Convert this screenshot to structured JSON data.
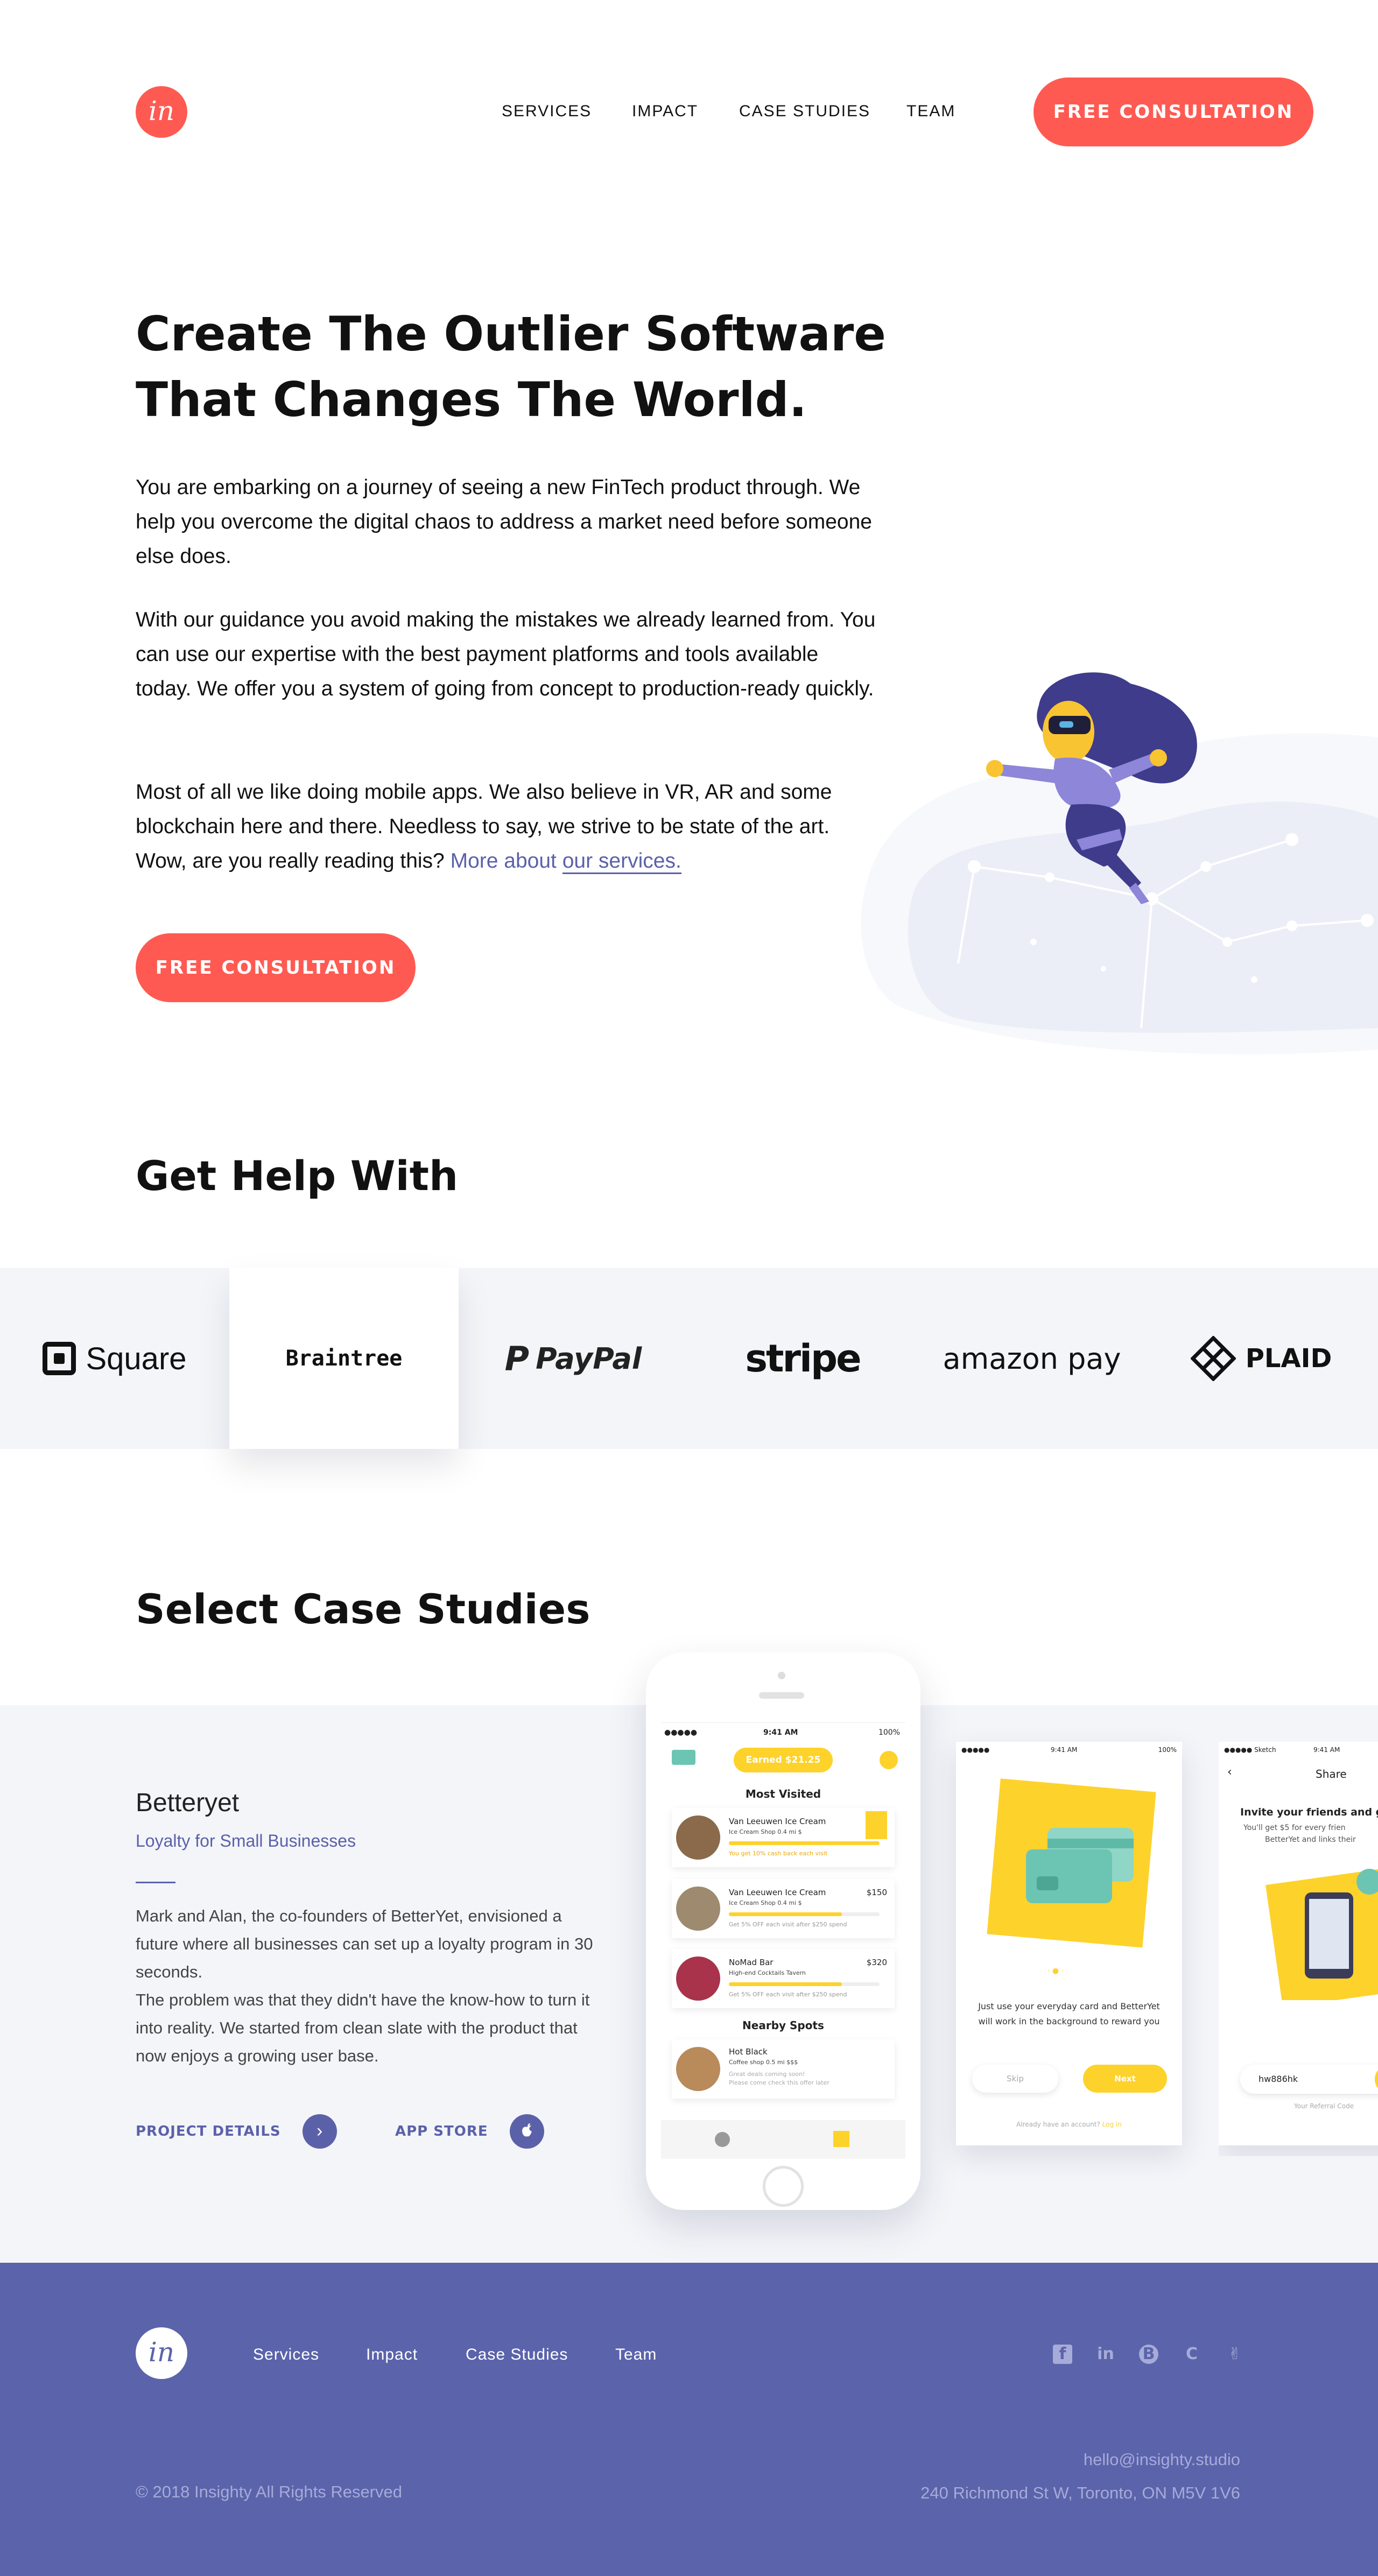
{
  "header": {
    "logo_text": "in",
    "nav": [
      "SERVICES",
      "IMPACT",
      "CASE STUDIES",
      "TEAM"
    ],
    "cta": "FREE CONSULTATION"
  },
  "hero": {
    "title_line1": "Create The Outlier Software",
    "title_line2": "That Changes The World.",
    "p1": "You are embarking on a journey of seeing a new FinTech product through. We help you overcome the digital chaos to address a market need before someone else does.",
    "p2": "With our guidance you avoid making the mistakes we already learned from. You can use our expertise with the best payment platforms and tools available today. We offer you a system of going from concept to production-ready quickly.",
    "p3": "Most of all we like doing mobile apps. We also believe in VR, AR and some blockchain here and there. Needless to say, we strive to be state of the art. Wow, are you really reading this?",
    "p3_link_a": "More about",
    "p3_link_b": "our services.",
    "cta": "FREE CONSULTATION"
  },
  "help": {
    "title": "Get Help With",
    "logos": [
      "Square",
      "Braintree",
      "PayPal",
      "stripe",
      "amazon pay",
      "PLAID"
    ]
  },
  "cases": {
    "title": "Select Case Studies",
    "name": "Betteryet",
    "subtitle": "Loyalty for Small Businesses",
    "description": "Mark and Alan, the co-founders of BetterYet, envisioned a future where all businesses can set up a loyalty program in 30 seconds.\nThe problem was that they didn't have the know-how to turn it into reality. We started from clean slate with the product that now enjoys a growing user base.",
    "project_details": "PROJECT DETAILS",
    "app_store": "APP STORE"
  },
  "phone": {
    "time": "9:41 AM",
    "battery": "100%",
    "earned": "Earned $21.25",
    "most_visited": "Most Visited",
    "items": [
      {
        "name": "Van Leeuwen Ice Cream",
        "sub": "Ice Cream Shop 0.4 mi $",
        "note": "You get 10% cash back each visit",
        "price": ""
      },
      {
        "name": "Van Leeuwen Ice Cream",
        "sub": "Ice Cream Shop 0.4 mi $",
        "note": "Get 5% OFF each visit after $250 spend",
        "price": "$150"
      },
      {
        "name": "NoMad Bar",
        "sub": "High-end Cocktails Tavern",
        "note": "Get 5% OFF each visit after $250 spend",
        "price": "$320"
      }
    ],
    "nearby": "Nearby Spots",
    "nearby_item": {
      "name": "Hot Black",
      "sub": "Coffee shop 0.5 mi $$$",
      "note1": "Great deals coming soon!",
      "note2": "Please come check this offer later"
    }
  },
  "screen2": {
    "time": "9:41 AM",
    "battery": "100%",
    "text": "Just use your everyday card and BetterYet will work in the background to reward you",
    "skip": "Skip",
    "next": "Next",
    "already": "Already have an account?",
    "login": "Log in"
  },
  "screen3": {
    "carrier": "Sketch",
    "time": "9:41 AM",
    "title": "Share",
    "invite": "Invite your friends and g",
    "body1": "You'll get $5 for every frien",
    "body2": "BetterYet and links their",
    "code": "hw886hk",
    "code_label": "Your Referral Code"
  },
  "footer": {
    "logo_text": "in",
    "nav": [
      "Services",
      "Impact",
      "Case Studies",
      "Team"
    ],
    "social_icons": [
      "facebook-icon",
      "linkedin-icon",
      "behance-icon",
      "crunchbase-icon",
      "angellist-icon"
    ],
    "copyright": "© 2018 Insighty All Rights Reserved",
    "email": "hello@insighty.studio",
    "address": "240 Richmond St W, Toronto, ON M5V 1V6"
  },
  "colors": {
    "accent": "#ff5a52",
    "brand": "#5b63ab",
    "yellow": "#fdd22b",
    "band": "#f3f5f9"
  }
}
